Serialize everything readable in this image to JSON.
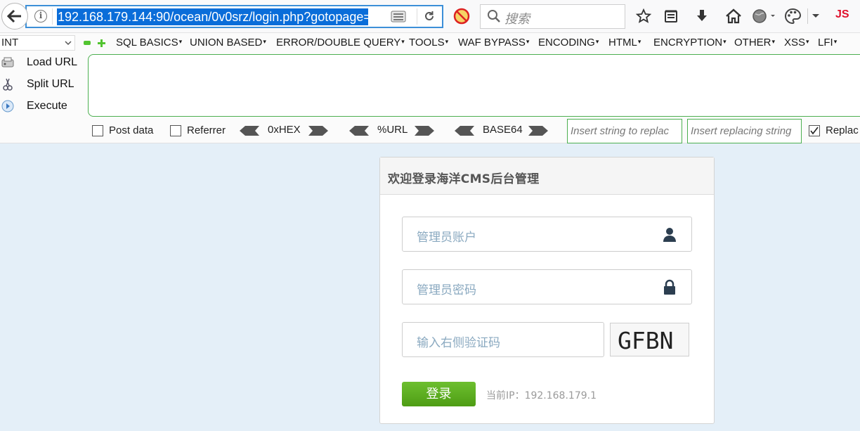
{
  "browser": {
    "url": "192.168.179.144:90/ocean/0v0srz/login.php?gotopage=",
    "search_placeholder": "搜索",
    "js_label": "JS"
  },
  "hackbar": {
    "int_select": "INT",
    "menus": [
      {
        "label": "SQL BASICS"
      },
      {
        "label": "UNION BASED"
      },
      {
        "label": "ERROR/DOUBLE QUERY"
      },
      {
        "label": "TOOLS"
      },
      {
        "label": "WAF BYPASS"
      },
      {
        "label": "ENCODING"
      },
      {
        "label": "HTML"
      },
      {
        "label": "ENCRYPTION"
      },
      {
        "label": "OTHER"
      },
      {
        "label": "XSS"
      },
      {
        "label": "LFI"
      }
    ],
    "load_url": "Load URL",
    "split_url": "Split URL",
    "execute": "Execute",
    "post_data": "Post data",
    "referrer": "Referrer",
    "hex": "0xHEX",
    "url_enc": "%URL",
    "base64": "BASE64",
    "insert_string_ph": "Insert string to replac",
    "insert_replacing_ph": "Insert replacing string",
    "replace_all": "Replac",
    "replace_checked": true
  },
  "login": {
    "title": "欢迎登录海洋CMS后台管理",
    "username_ph": "管理员账户",
    "password_ph": "管理员密码",
    "captcha_ph": "输入右侧验证码",
    "captcha_text": "GFBN",
    "submit": "登录",
    "ip_label": "当前IP：192.168.179.1"
  }
}
